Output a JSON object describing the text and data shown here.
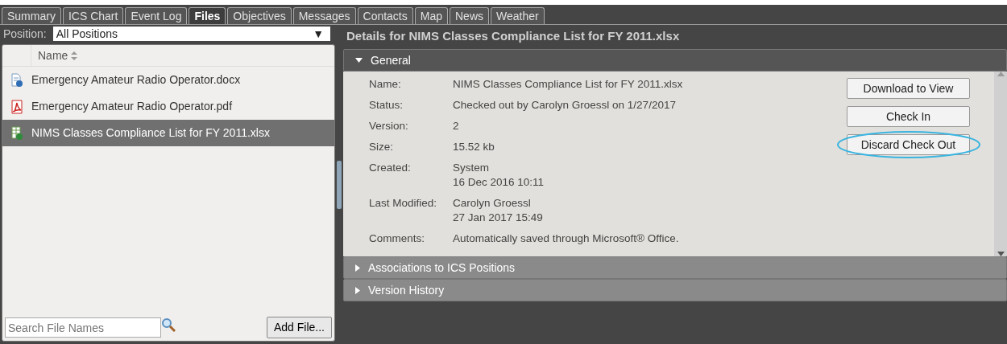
{
  "tabs": [
    {
      "label": "Summary",
      "selected": false
    },
    {
      "label": "ICS Chart",
      "selected": false
    },
    {
      "label": "Event Log",
      "selected": false
    },
    {
      "label": "Files",
      "selected": true
    },
    {
      "label": "Objectives",
      "selected": false
    },
    {
      "label": "Messages",
      "selected": false
    },
    {
      "label": "Contacts",
      "selected": false
    },
    {
      "label": "Map",
      "selected": false
    },
    {
      "label": "News",
      "selected": false
    },
    {
      "label": "Weather",
      "selected": false
    }
  ],
  "position_filter": {
    "label": "Position:",
    "value": "All Positions",
    "arrow": "▼"
  },
  "file_list": {
    "column": "Name",
    "files": [
      {
        "name": "Emergency Amateur Radio Operator.docx",
        "kind": "docx",
        "selected": false
      },
      {
        "name": "Emergency Amateur Radio Operator.pdf",
        "kind": "pdf",
        "selected": false
      },
      {
        "name": "NIMS Classes Compliance List for FY 2011.xlsx",
        "kind": "xlsx",
        "selected": true
      }
    ]
  },
  "search": {
    "placeholder": "Search File Names"
  },
  "add_button": "Add File...",
  "details": {
    "title": "Details for NIMS Classes Compliance List for FY 2011.xlsx",
    "sections": [
      {
        "title": "General",
        "expanded": true
      },
      {
        "title": "Associations to ICS Positions",
        "expanded": false
      },
      {
        "title": "Version History",
        "expanded": false
      }
    ],
    "fields": [
      {
        "label": "Name:",
        "lines": [
          "NIMS Classes Compliance List for FY 2011.xlsx"
        ]
      },
      {
        "label": "Status:",
        "lines": [
          "Checked out by Carolyn Groessl on 1/27/2017"
        ]
      },
      {
        "label": "Version:",
        "lines": [
          "2"
        ]
      },
      {
        "label": "Size:",
        "lines": [
          "15.52 kb"
        ]
      },
      {
        "label": "Created:",
        "lines": [
          "System",
          "16 Dec 2016 10:11"
        ]
      },
      {
        "label": "Last Modified:",
        "lines": [
          "Carolyn Groessl",
          "27 Jan 2017 15:49"
        ]
      },
      {
        "label": "Comments:",
        "lines": [
          "Automatically saved through Microsoft® Office."
        ]
      }
    ],
    "buttons": [
      {
        "label": "Download to View",
        "circled": false
      },
      {
        "label": "Check In",
        "circled": false
      },
      {
        "label": "Discard Check Out",
        "circled": true
      }
    ]
  }
}
